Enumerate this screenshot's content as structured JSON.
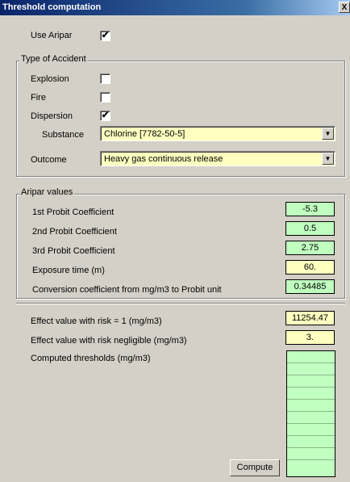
{
  "window": {
    "title": "Threshold computation",
    "close_label": "X"
  },
  "use_aripar": {
    "label": "Use Aripar",
    "checked": true
  },
  "accident": {
    "legend": "Type of Accident",
    "explosion": {
      "label": "Explosion",
      "checked": false
    },
    "fire": {
      "label": "Fire",
      "checked": false
    },
    "dispersion": {
      "label": "Dispersion",
      "checked": true
    },
    "substance_label": "Substance",
    "substance_value": "Chlorine [7782-50-5]",
    "outcome_label": "Outcome",
    "outcome_value": "Heavy gas continuous release"
  },
  "aripar": {
    "legend": "Aripar values",
    "rows": [
      {
        "label": "1st Probit Coefficient",
        "value": "-5.3",
        "color": "#c0ffc0"
      },
      {
        "label": "2nd Probit Coefficient",
        "value": "0.5",
        "color": "#c0ffc0"
      },
      {
        "label": "3rd Probit Coefficient",
        "value": "2.75",
        "color": "#c0ffc0"
      },
      {
        "label": "Exposure time (m)",
        "value": "60.",
        "color": "#ffffc0"
      },
      {
        "label": "Conversion coefficient from mg/m3 to Probit unit",
        "value": "0.34485",
        "color": "#c0ffc0"
      }
    ]
  },
  "effects": {
    "risk1_label": "Effect value with risk = 1 (mg/m3)",
    "risk1_value": "11254.47",
    "negligible_label": "Effect value with risk negligible (mg/m3)",
    "negligible_value": "3.",
    "computed_label": "Computed thresholds (mg/m3)"
  },
  "compute_button": "Compute",
  "glyphs": {
    "check": "✔",
    "dropdown": "▼"
  }
}
